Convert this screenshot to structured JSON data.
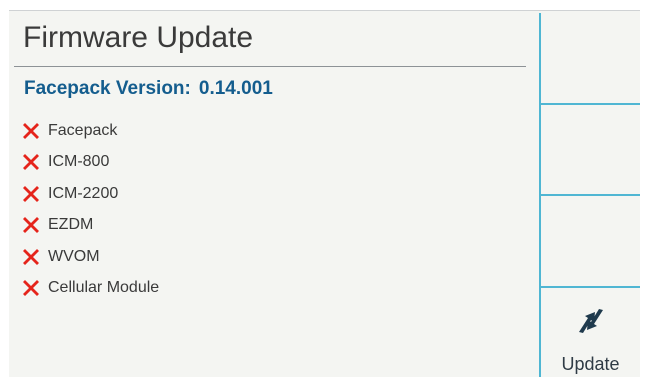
{
  "title": "Firmware Update",
  "facepack": {
    "label": "Facepack Version:",
    "version": "0.14.001"
  },
  "modules": [
    {
      "label": "Facepack",
      "status": "failed",
      "icon": "red-x-icon"
    },
    {
      "label": "ICM-800",
      "status": "failed",
      "icon": "red-x-icon"
    },
    {
      "label": "ICM-2200",
      "status": "failed",
      "icon": "red-x-icon"
    },
    {
      "label": "EZDM",
      "status": "failed",
      "icon": "red-x-icon"
    },
    {
      "label": "WVOM",
      "status": "failed",
      "icon": "red-x-icon"
    },
    {
      "label": "Cellular Module",
      "status": "failed",
      "icon": "red-x-icon"
    }
  ],
  "softkeys": {
    "key1": "",
    "key2": "",
    "key3": "",
    "update": {
      "label": "Update",
      "icon": "update-arrows-icon"
    }
  },
  "colors": {
    "accent": "#4fb6d3",
    "version_text": "#145d8e",
    "error": "#e5241b",
    "icon_dark": "#1f3a4d"
  }
}
